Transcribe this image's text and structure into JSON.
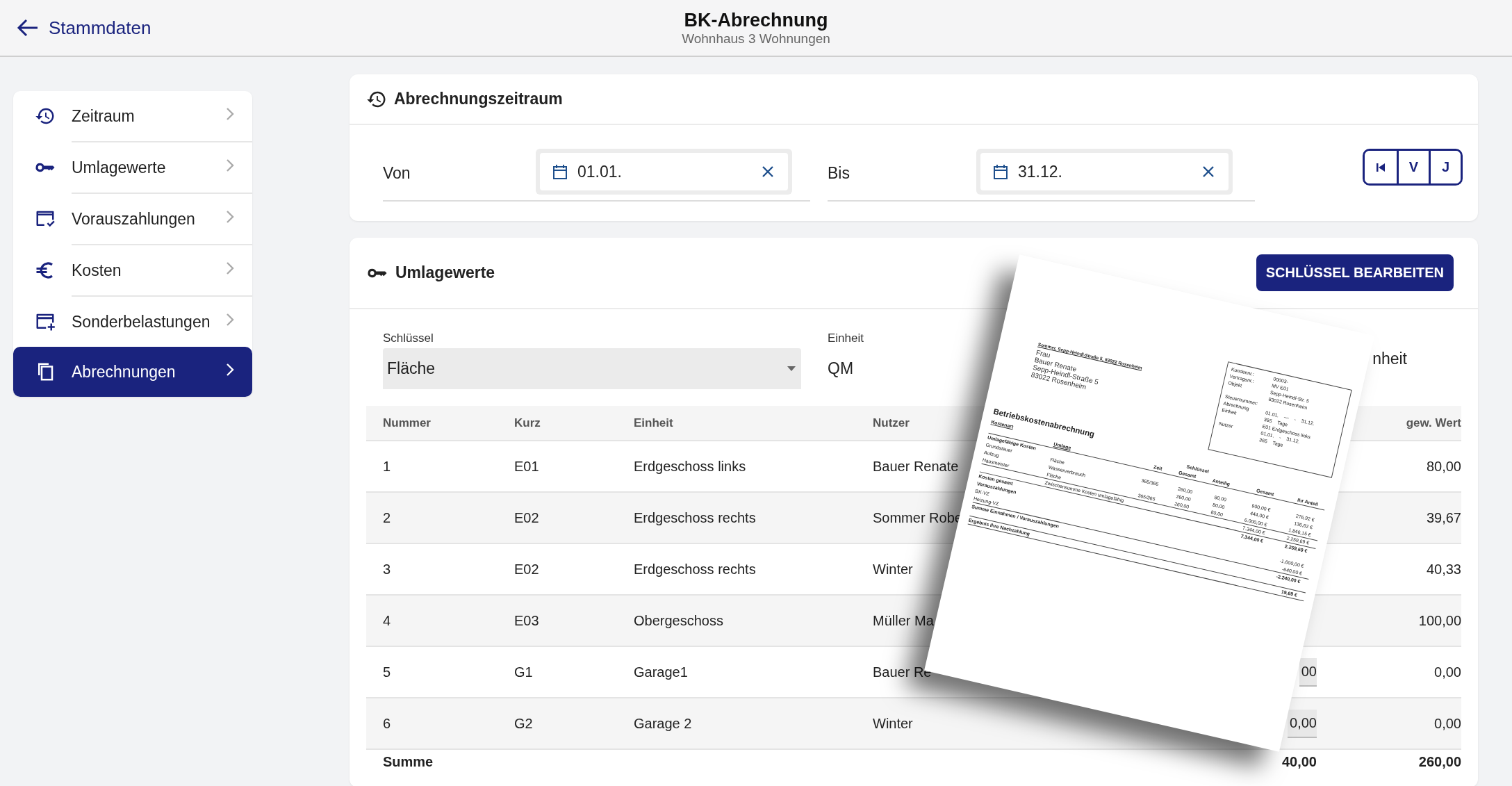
{
  "header": {
    "back_link": "Stammdaten",
    "title": "BK-Abrechnung",
    "subtitle": "Wohnhaus 3 Wohnungen"
  },
  "sidebar": {
    "items": [
      {
        "label": "Zeitraum",
        "selected": false
      },
      {
        "label": "Umlagewerte",
        "selected": false
      },
      {
        "label": "Vorauszahlungen",
        "selected": false
      },
      {
        "label": "Kosten",
        "selected": false
      },
      {
        "label": "Sonderbelastungen",
        "selected": false
      },
      {
        "label": "Abrechnungen",
        "selected": true
      }
    ]
  },
  "period": {
    "title": "Abrechnungszeitraum",
    "fields": [
      {
        "label": "Von",
        "value": "01.01."
      },
      {
        "label": "Bis",
        "value": "31.12."
      }
    ],
    "buttons": [
      "V",
      "J"
    ]
  },
  "allocation": {
    "title": "Umlagewerte",
    "edit_button": "SCHLÜSSEL BEARBEITEN",
    "key_field": {
      "label": "Schlüssel",
      "value": "Fläche"
    },
    "unit_field": {
      "label": "Einheit",
      "value": "QM"
    },
    "column_3_fragment": "nheit",
    "table": {
      "columns": [
        "Nummer",
        "Kurz",
        "Einheit",
        "Nutzer",
        "gew. Wert"
      ],
      "rows": [
        {
          "nummer": "1",
          "kurz": "E01",
          "einheit": "Erdgeschoss links",
          "nutzer": "Bauer Renate",
          "gew_wert": "80,00"
        },
        {
          "nummer": "2",
          "kurz": "E02",
          "einheit": "Erdgeschoss rechts",
          "nutzer": "Sommer Robe",
          "gew_wert": "39,67"
        },
        {
          "nummer": "3",
          "kurz": "E02",
          "einheit": "Erdgeschoss rechts",
          "nutzer": "Winter",
          "gew_wert": "40,33"
        },
        {
          "nummer": "4",
          "kurz": "E03",
          "einheit": "Obergeschoss",
          "nutzer": "Müller Ma",
          "gew_wert": "100,00"
        },
        {
          "nummer": "5",
          "kurz": "G1",
          "einheit": "Garage1",
          "nutzer": "Bauer Re",
          "column_5": "00",
          "gew_wert": "0,00"
        },
        {
          "nummer": "6",
          "kurz": "G2",
          "einheit": "Garage 2",
          "nutzer": "Winter",
          "column_5": "0,00",
          "gew_wert": "0,00"
        }
      ],
      "total": {
        "label": "Summe",
        "column_5": "40,00",
        "gew_wert": "260,00"
      }
    }
  },
  "document": {
    "sender_line": "Sommer, Sepp-Heindl-Straße 5, 83022 Rosenheim",
    "recipient": [
      "Frau",
      "Bauer Renate",
      "Sepp-Heindl-Straße 5",
      "83022 Rosenheim"
    ],
    "info_box": [
      {
        "label": "Kundennr.:",
        "values": [
          "00003-"
        ]
      },
      {
        "label": "Vertragsnr.:",
        "values": [
          "MV E01"
        ]
      },
      {
        "label": "Objekt",
        "values": [
          "Sepp-Heindl-Str. 5"
        ]
      },
      {
        "values": [
          "83022 Rosenheim"
        ]
      },
      {
        "label": "Steuernummer:"
      },
      {
        "label": "Abrechnung",
        "values": [
          "01.01.",
          "—",
          "-",
          "31.12."
        ]
      },
      {
        "label": "Einheit",
        "values": [
          "365",
          "Tage"
        ]
      },
      {
        "values": [
          "E01 Erdgeschoss links"
        ]
      },
      {
        "label": "Nutzer",
        "values": [
          "01.01.",
          "-",
          "31.12."
        ]
      },
      {
        "values": [
          "365",
          "Tage"
        ]
      }
    ],
    "title": "Betriebskostenabrechnung",
    "columns": {
      "name": "Kostenart",
      "umlage": "Umlage",
      "zeit": "Zeit",
      "schluessel": "Schlüssel",
      "schluessel_gesamt": "Gesamt",
      "schluessel_anteilig": "Anteilig",
      "gesamt": "Gesamt",
      "ihr_anteil": "Ihr Anteil"
    },
    "rows": [
      {
        "kind": "section",
        "name": "Umlagefähige Kosten"
      },
      {
        "kind": "item",
        "name": "Grundsteuer",
        "umlage": "Fläche",
        "zeit": "365/365",
        "schluessel_gesamt": "260,00",
        "schluessel_anteilig": "80,00",
        "gesamt": "900,00 €",
        "ihr_anteil": "276,92 €"
      },
      {
        "kind": "item",
        "name": "Aufzug",
        "umlage": "Wasserverbrauch",
        "schluessel_gesamt": "260,00",
        "schluessel_anteilig": "80,00",
        "gesamt": "444,00 €",
        "ihr_anteil": "136,62 €"
      },
      {
        "kind": "item",
        "name": "Hausmeister",
        "umlage": "Fläche",
        "zeit": "365/365",
        "schluessel_gesamt": "260,00",
        "schluessel_anteilig": "80,00",
        "gesamt": "6.000,00 €",
        "ihr_anteil": "1.846,15 €"
      },
      {
        "kind": "subtotal",
        "umlage": "Zwischensumme Kosten umlagefähig",
        "gesamt": "7.344,00 €",
        "ihr_anteil": "2.259,69 €"
      },
      {
        "kind": "total",
        "name": "Kosten gesamt",
        "gesamt": "7.344,00 €",
        "ihr_anteil": "2.259,69 €"
      },
      {
        "kind": "section",
        "name": "Vorauszahlungen"
      },
      {
        "kind": "item",
        "name": "BK-VZ",
        "ihr_anteil": "-1.600,00 €"
      },
      {
        "kind": "item",
        "name": "Heizung-VZ",
        "ihr_anteil": "-640,00 €"
      },
      {
        "kind": "total",
        "name": "Summe Einnahmen / Vorauszahlungen",
        "ihr_anteil": "-2.240,00 €"
      },
      {
        "kind": "result",
        "name": "Ergebnis Ihre Nachzahlung",
        "ihr_anteil": "19,69 €"
      }
    ]
  }
}
